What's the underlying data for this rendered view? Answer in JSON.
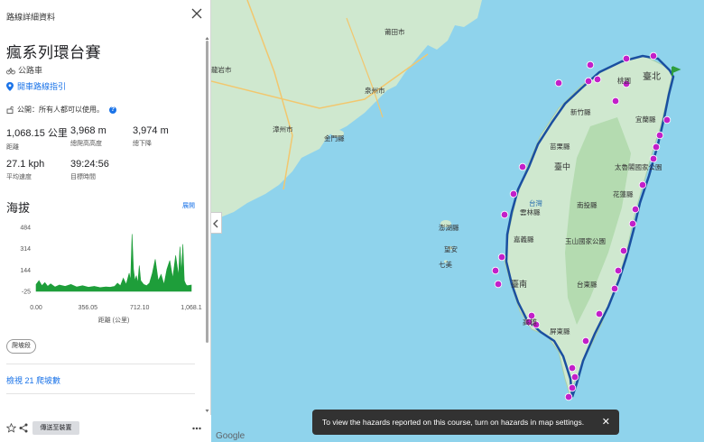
{
  "panel": {
    "header": "路線詳細資料",
    "title": "瘋系列環台賽",
    "sport": "公路車",
    "navigate": "開車路線指引",
    "access": "公開：所有人都可以使用。",
    "stats": [
      {
        "value": "1,068.15 公里",
        "label": "距離"
      },
      {
        "value": "3,968 m",
        "label": "總爬高高度"
      },
      {
        "value": "3,974 m",
        "label": "總下降"
      },
      {
        "value": "27.1 kph",
        "label": "平均速度"
      },
      {
        "value": "39:24:56",
        "label": "目標時間"
      }
    ],
    "elevation_title": "海拔",
    "expand": "展開",
    "climb_chip": "爬坡段",
    "view_climbs": "檢視 21 爬坡數",
    "send_button": "傳送至裝置"
  },
  "chart_data": {
    "type": "area",
    "title": "海拔",
    "xlabel": "距離 (公里)",
    "ylabel": "",
    "x_ticks": [
      "0.00",
      "356.05",
      "712.10",
      "1,068.1"
    ],
    "y_ticks": [
      "484",
      "314",
      "144",
      "-25"
    ],
    "xlim": [
      0,
      1068.15
    ],
    "ylim": [
      -25,
      484
    ],
    "series": [
      {
        "x": [
          0,
          20,
          40,
          60,
          80,
          100,
          130,
          160,
          200,
          240,
          280,
          320,
          360,
          400,
          440,
          480,
          510,
          540,
          560,
          580,
          600,
          620,
          640,
          650,
          660,
          670,
          680,
          690,
          700,
          710,
          720,
          740,
          760,
          780,
          800,
          820,
          840,
          860,
          880,
          900,
          920,
          940,
          960,
          980,
          990,
          1000,
          1010,
          1020,
          1030,
          1040,
          1068
        ],
        "values": [
          30,
          60,
          20,
          45,
          15,
          35,
          10,
          25,
          15,
          30,
          10,
          20,
          8,
          15,
          5,
          10,
          8,
          15,
          40,
          20,
          80,
          30,
          120,
          60,
          430,
          150,
          60,
          100,
          40,
          180,
          60,
          30,
          20,
          40,
          120,
          230,
          60,
          110,
          30,
          150,
          220,
          80,
          260,
          100,
          330,
          120,
          350,
          60,
          30,
          20,
          25
        ]
      }
    ],
    "grid": false,
    "color": "#1e9e3a"
  },
  "map": {
    "labels": [
      "莆田市",
      "龍岩市",
      "泉州市",
      "漳州市",
      "金門縣",
      "澎湖縣",
      "望安",
      "七美",
      "桃園",
      "臺北",
      "新竹縣",
      "宜蘭縣",
      "苗栗縣",
      "臺中",
      "太魯閣國家公園",
      "花蓮縣",
      "南投縣",
      "雲林縣",
      "嘉義縣",
      "玉山國家公園",
      "臺南",
      "台東縣",
      "屏東縣",
      "高雄",
      "台灣"
    ],
    "route_color": "#1a4fa0",
    "marker_color": "#c21fc9",
    "land_color": "#cfe8cf",
    "sea_color": "#8fd3ec"
  },
  "toast": {
    "message": "To view the hazards reported on this course, turn on hazards in map settings.",
    "close": "✕"
  },
  "google": "Google"
}
